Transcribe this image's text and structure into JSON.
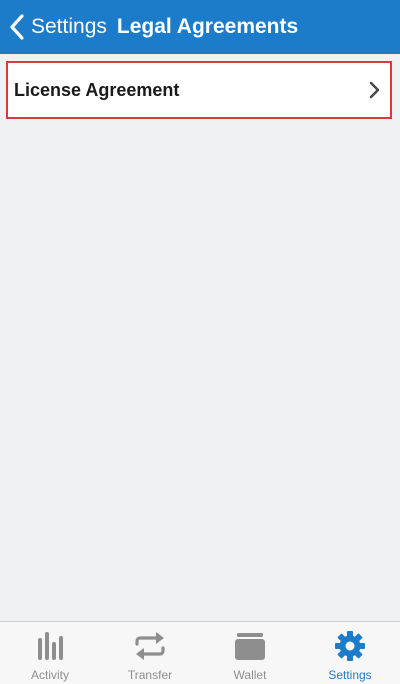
{
  "nav": {
    "back_label": "Settings",
    "title": "Legal Agreements"
  },
  "list": {
    "items": [
      {
        "label": "License Agreement"
      }
    ]
  },
  "tabs": [
    {
      "label": "Activity",
      "icon": "bar-chart-icon"
    },
    {
      "label": "Transfer",
      "icon": "transfer-arrows-icon"
    },
    {
      "label": "Wallet",
      "icon": "wallet-icon"
    },
    {
      "label": "Settings",
      "icon": "gear-icon",
      "active": true
    }
  ],
  "colors": {
    "nav_background": "#1d7cc9",
    "accent": "#1d7cc9",
    "selected_row_border": "#d93a3a",
    "inactive_tab": "#8e8e8e"
  }
}
